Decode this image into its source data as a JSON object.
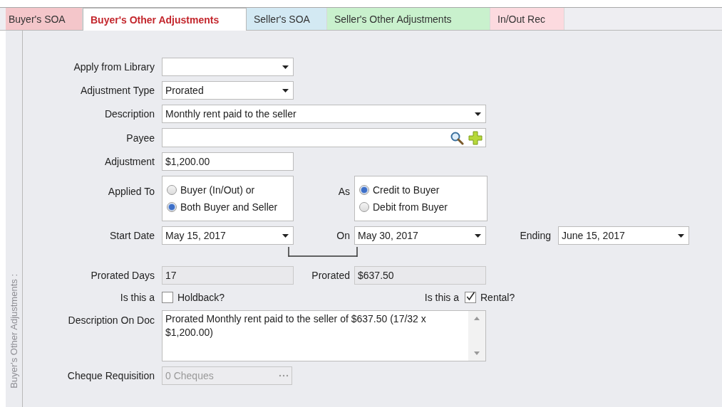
{
  "tabs": [
    {
      "label": "Buyer's SOA",
      "selected": false,
      "color": "#f4c6ca"
    },
    {
      "label": "Buyer's Other Adjustments",
      "selected": true,
      "color": "#ffffff"
    },
    {
      "label": "Seller's SOA",
      "selected": false,
      "color": "#d3e9f3"
    },
    {
      "label": "Seller's Other Adjustments",
      "selected": false,
      "color": "#c9f1cd"
    },
    {
      "label": "In/Out Rec",
      "selected": false,
      "color": "#fcdadf"
    }
  ],
  "side_label": "Buyer's Other Adjustments :",
  "apply_from_library": {
    "label": "Apply from Library"
  },
  "adjustment_type": {
    "label": "Adjustment Type",
    "value": "Prorated"
  },
  "description": {
    "label": "Description",
    "value": "Monthly rent paid to the seller"
  },
  "payee": {
    "label": "Payee"
  },
  "adjustment": {
    "label": "Adjustment",
    "value": "$1,200.00"
  },
  "applied_to": {
    "label": "Applied To",
    "options": [
      {
        "label": "Buyer (In/Out) or",
        "selected": false
      },
      {
        "label": "Both Buyer and Seller",
        "selected": true
      }
    ]
  },
  "as": {
    "label": "As",
    "options": [
      {
        "label": "Credit to Buyer",
        "selected": true
      },
      {
        "label": "Debit from Buyer",
        "selected": false
      }
    ]
  },
  "start_date": {
    "label": "Start Date",
    "value": "May 15, 2017"
  },
  "on": {
    "label": "On",
    "value": "May 30, 2017"
  },
  "ending": {
    "label": "Ending",
    "value": "June 15, 2017"
  },
  "prorated_days": {
    "label": "Prorated Days",
    "value": "17"
  },
  "prorated": {
    "label": "Prorated",
    "value": "$637.50"
  },
  "holdback": {
    "prefix": "Is this a",
    "label": "Holdback?",
    "checked": false
  },
  "rental": {
    "prefix": "Is this a",
    "label": "Rental?",
    "checked": true
  },
  "description_on_doc": {
    "label": "Description On Doc",
    "value": "Prorated Monthly rent paid to the seller of $637.50 (17/32 x $1,200.00)"
  },
  "cheque_requisition": {
    "label": "Cheque Requisition",
    "value": "0 Cheques",
    "disabled": true
  }
}
